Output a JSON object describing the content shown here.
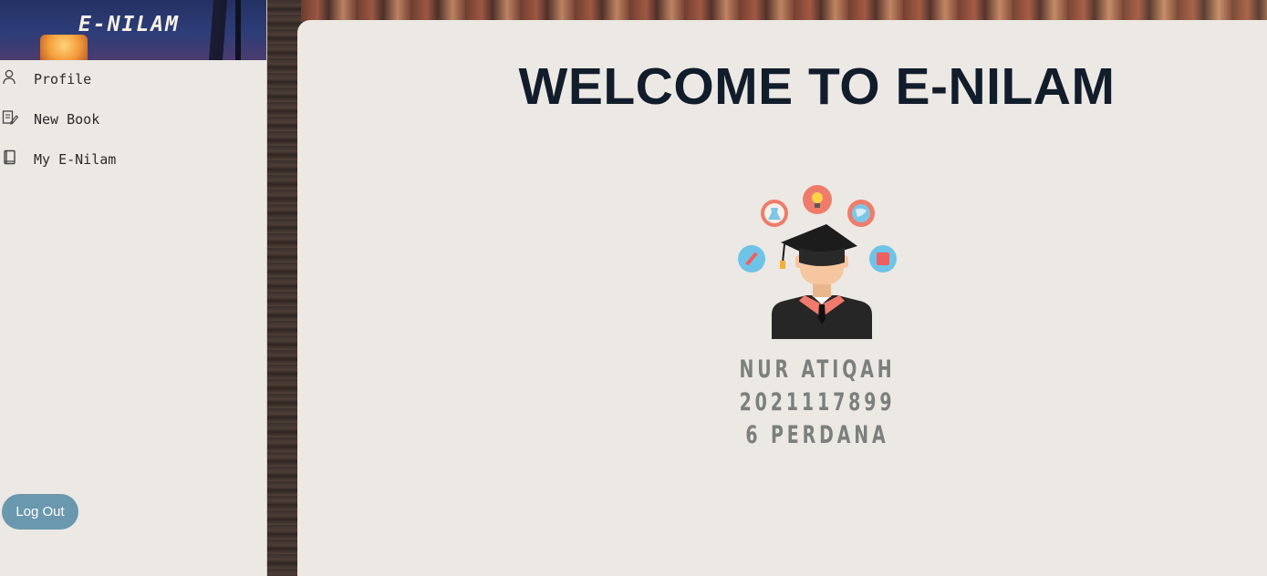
{
  "sidebar": {
    "brand": "E-NILAM",
    "items": [
      {
        "label": "Profile",
        "icon": "user-icon"
      },
      {
        "label": "New Book",
        "icon": "edit-book-icon"
      },
      {
        "label": "My E-Nilam",
        "icon": "book-icon"
      }
    ],
    "logout_label": "Log Out"
  },
  "main": {
    "title": "WELCOME TO E-NILAM",
    "avatar_icon": "graduate-icon",
    "student": {
      "name": "NUR ATIQAH",
      "id": "2021117899",
      "class": "6 PERDANA"
    }
  },
  "colors": {
    "title": "#111d2b",
    "panel": "#ece8e3",
    "logout_button": "#6a98ae",
    "student_text": "#7b807d"
  }
}
